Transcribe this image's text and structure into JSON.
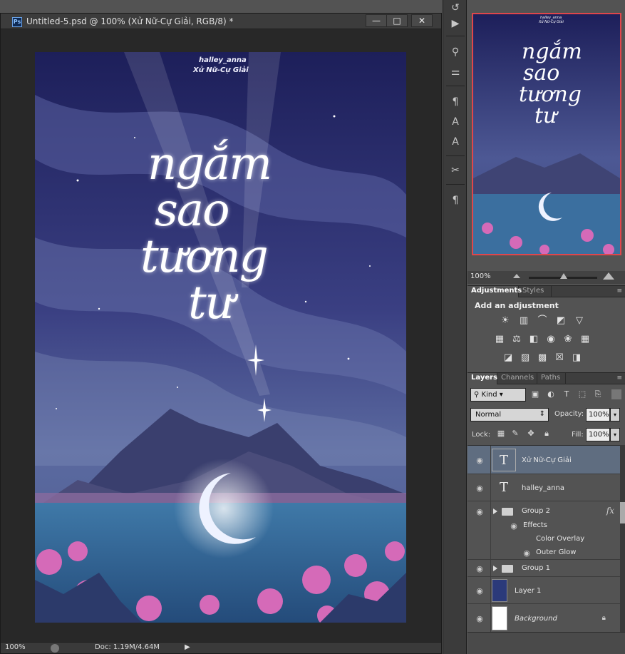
{
  "document": {
    "title": "Untitled-5.psd @ 100% (Xử Nữ-Cự Giải, RGB/8) *",
    "app_badge": "Ps",
    "window_buttons": [
      "—",
      "□",
      "✕"
    ],
    "status_zoom": "100%",
    "status_doc": "Doc: 1.19M/4.64M",
    "status_arrow": "▶"
  },
  "artwork": {
    "author": "halley_anna",
    "tag": "Xử Nữ-Cự Giải",
    "title_lines": [
      "ngắm",
      "sao",
      "tương",
      "tư"
    ],
    "colors": {
      "sky": "#232862",
      "lake": "#2d5a8c",
      "flowers": "#c65fb0"
    }
  },
  "navigator": {
    "thumb_title_lines": [
      "ngắm",
      "sao",
      "tương",
      "tư"
    ],
    "thumb_author": "halley_anna",
    "thumb_tag": "Xử Nữ-Cự Giải",
    "zoom": "100%"
  },
  "adjustments": {
    "tabs": [
      "Adjustments",
      "Styles"
    ],
    "heading": "Add an adjustment",
    "icons_row1": [
      "brightness-icon",
      "levels-icon",
      "curves-icon",
      "exposure-icon",
      "vibrance-icon"
    ],
    "icons_row2": [
      "hue-icon",
      "balance-icon",
      "bw-icon",
      "photo-filter-icon",
      "channel-mixer-icon",
      "lookup-icon"
    ],
    "icons_row3": [
      "invert-icon",
      "posterize-icon",
      "threshold-icon",
      "selective-color-icon",
      "gradient-map-icon"
    ]
  },
  "layers_panel": {
    "tabs": [
      "Layers",
      "Channels",
      "Paths"
    ],
    "kind_label": "Kind",
    "blend_mode": "Normal",
    "opacity_label": "Opacity:",
    "opacity_value": "100%",
    "lock_label": "Lock:",
    "fill_label": "Fill:",
    "fill_value": "100%",
    "layers": [
      {
        "name": "Xử Nữ-Cự Giải",
        "type": "text",
        "selected": true
      },
      {
        "name": "halley_anna",
        "type": "text",
        "selected": false
      },
      {
        "name": "Group 2",
        "type": "group",
        "fx": "fx"
      },
      {
        "name": "Effects",
        "type": "effects-header"
      },
      {
        "name": "Color Overlay",
        "type": "effect"
      },
      {
        "name": "Outer Glow",
        "type": "effect"
      },
      {
        "name": "Group 1",
        "type": "group"
      },
      {
        "name": "Layer 1",
        "type": "pixel"
      },
      {
        "name": "Background",
        "type": "background",
        "locked": true
      }
    ]
  }
}
